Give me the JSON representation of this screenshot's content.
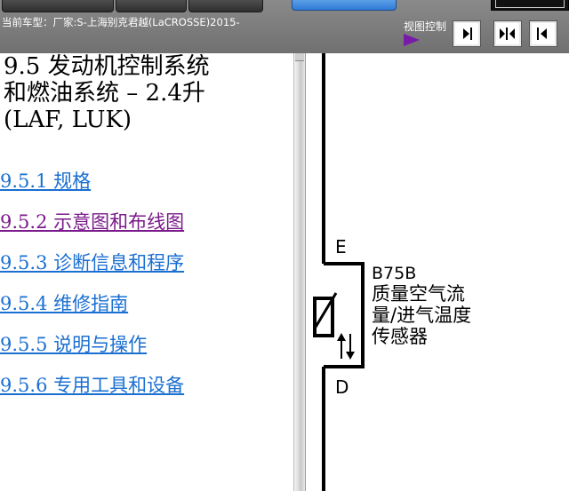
{
  "toolbar": {
    "car_info": "当前车型：厂家:S-上海别克君越(LaCROSSE)2015-",
    "view_control_label": "视图控制"
  },
  "document": {
    "title_lines": [
      "9.5 发动机控制系统",
      "和燃油系统 – 2.4升",
      "(LAF, LUK)"
    ],
    "toc": [
      {
        "label": "9.5.1 规格"
      },
      {
        "label": "9.5.2 示意图和布线图"
      },
      {
        "label": "9.5.3 诊断信息和程序"
      },
      {
        "label": "9.5.4 维修指南"
      },
      {
        "label": "9.5.5 说明与操作"
      },
      {
        "label": "9.5.6 专用工具和设备"
      }
    ]
  },
  "diagram": {
    "pin_top": "E",
    "pin_bottom": "D",
    "component_code": "B75B",
    "component_name_lines": [
      "质量空气流",
      "量/进气温度",
      "传感器"
    ]
  },
  "colors": {
    "link": "#1a6fd1",
    "visited_link": "#7a1a8a",
    "toolbar_bg": "#7e7e7e",
    "view_arrow": "#7a1aa8"
  }
}
